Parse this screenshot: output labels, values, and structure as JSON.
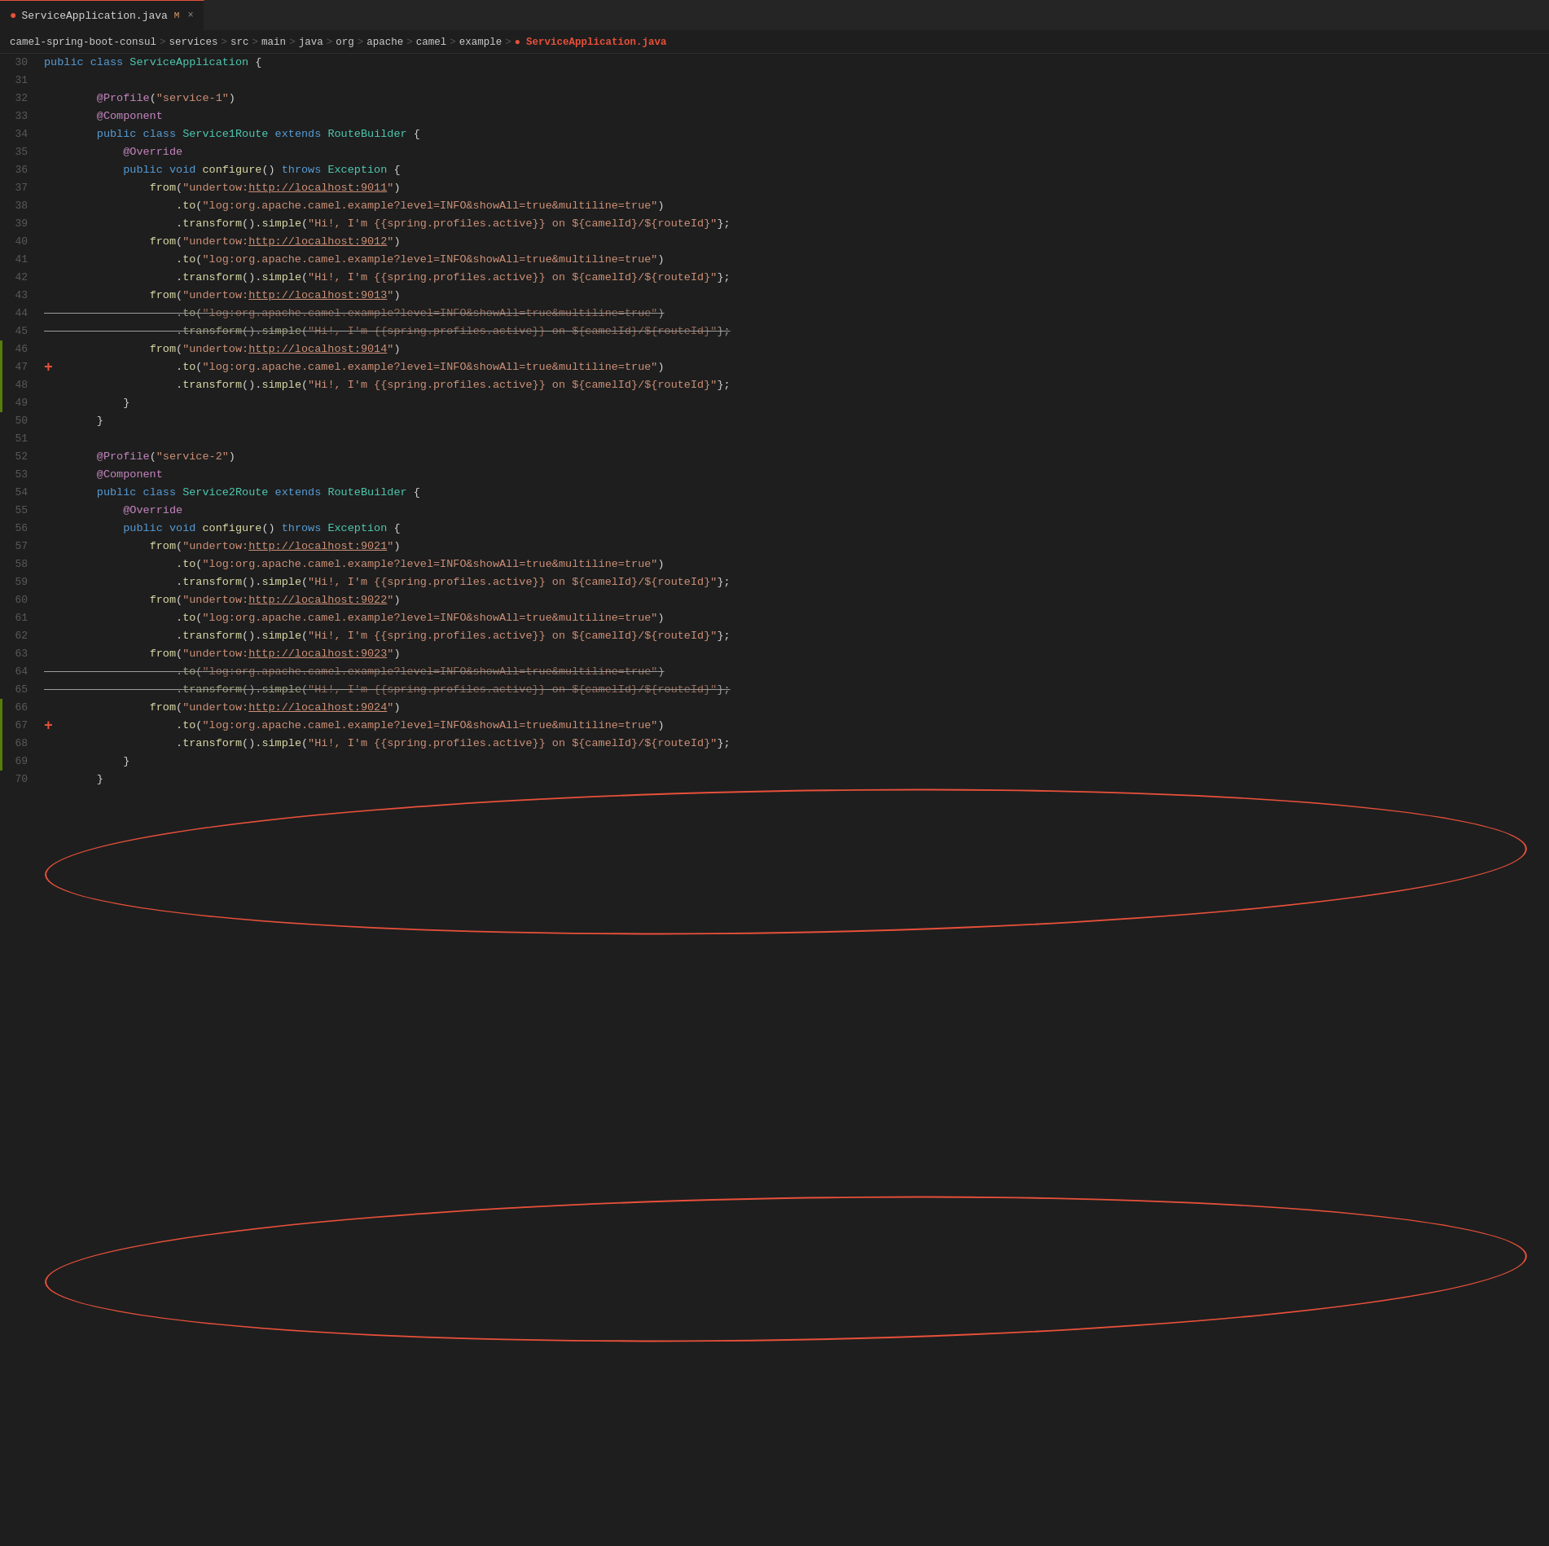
{
  "tab": {
    "icon": "●",
    "filename": "ServiceApplication.java",
    "modified": "M",
    "close": "×"
  },
  "breadcrumb": {
    "parts": [
      "camel-spring-boot-consul",
      "services",
      "src",
      "main",
      "java",
      "org",
      "apache",
      "camel",
      "example",
      "ServiceApplication.java"
    ]
  },
  "lines": [
    {
      "num": "30",
      "tokens": [
        {
          "t": "kw",
          "v": "public"
        },
        {
          "t": "plain",
          "v": " "
        },
        {
          "t": "kw",
          "v": "class"
        },
        {
          "t": "plain",
          "v": " "
        },
        {
          "t": "type",
          "v": "ServiceApplication"
        },
        {
          "t": "plain",
          "v": " {"
        }
      ]
    },
    {
      "num": "31",
      "tokens": []
    },
    {
      "num": "32",
      "tokens": [
        {
          "t": "plain",
          "v": "        "
        },
        {
          "t": "annot",
          "v": "@Profile"
        },
        {
          "t": "plain",
          "v": "("
        },
        {
          "t": "str",
          "v": "\"service-1\""
        },
        {
          "t": "plain",
          "v": ")"
        }
      ]
    },
    {
      "num": "33",
      "tokens": [
        {
          "t": "plain",
          "v": "        "
        },
        {
          "t": "annot",
          "v": "@Component"
        }
      ]
    },
    {
      "num": "34",
      "tokens": [
        {
          "t": "plain",
          "v": "        "
        },
        {
          "t": "kw",
          "v": "public"
        },
        {
          "t": "plain",
          "v": " "
        },
        {
          "t": "kw",
          "v": "class"
        },
        {
          "t": "plain",
          "v": " "
        },
        {
          "t": "type",
          "v": "Service1Route"
        },
        {
          "t": "plain",
          "v": " "
        },
        {
          "t": "kw",
          "v": "extends"
        },
        {
          "t": "plain",
          "v": " "
        },
        {
          "t": "type",
          "v": "RouteBuilder"
        },
        {
          "t": "plain",
          "v": " {"
        }
      ]
    },
    {
      "num": "35",
      "tokens": [
        {
          "t": "plain",
          "v": "            "
        },
        {
          "t": "annot",
          "v": "@Override"
        }
      ]
    },
    {
      "num": "36",
      "tokens": [
        {
          "t": "plain",
          "v": "            "
        },
        {
          "t": "kw",
          "v": "public"
        },
        {
          "t": "plain",
          "v": " "
        },
        {
          "t": "kw",
          "v": "void"
        },
        {
          "t": "plain",
          "v": " "
        },
        {
          "t": "fn",
          "v": "configure"
        },
        {
          "t": "plain",
          "v": "() "
        },
        {
          "t": "kw",
          "v": "throws"
        },
        {
          "t": "plain",
          "v": " "
        },
        {
          "t": "type",
          "v": "Exception"
        },
        {
          "t": "plain",
          "v": " {"
        }
      ]
    },
    {
      "num": "37",
      "tokens": [
        {
          "t": "plain",
          "v": "                "
        },
        {
          "t": "fn",
          "v": "from"
        },
        {
          "t": "plain",
          "v": "("
        },
        {
          "t": "str",
          "v": "\"undertow:"
        },
        {
          "t": "str-link",
          "v": "http://localhost:9011"
        },
        {
          "t": "str",
          "v": "\""
        },
        {
          "t": "plain",
          "v": ")"
        }
      ]
    },
    {
      "num": "38",
      "tokens": [
        {
          "t": "plain",
          "v": "                    ."
        },
        {
          "t": "fn",
          "v": "to"
        },
        {
          "t": "plain",
          "v": "("
        },
        {
          "t": "str",
          "v": "\"log:org.apache.camel.example?level=INFO&showAll=true&multiline=true\""
        },
        {
          "t": "plain",
          "v": ")"
        }
      ]
    },
    {
      "num": "39",
      "tokens": [
        {
          "t": "plain",
          "v": "                    ."
        },
        {
          "t": "fn",
          "v": "transform"
        },
        {
          "t": "plain",
          "v": "()."
        },
        {
          "t": "fn",
          "v": "simple"
        },
        {
          "t": "plain",
          "v": "("
        },
        {
          "t": "str",
          "v": "\"Hi!, I'm {{spring.profiles.active}} on ${camelId}/${routeId}\""
        },
        {
          "t": "plain",
          "v": "};"
        }
      ]
    },
    {
      "num": "40",
      "tokens": [
        {
          "t": "plain",
          "v": "                "
        },
        {
          "t": "fn",
          "v": "from"
        },
        {
          "t": "plain",
          "v": "("
        },
        {
          "t": "str",
          "v": "\"undertow:"
        },
        {
          "t": "str-link",
          "v": "http://localhost:9012"
        },
        {
          "t": "str",
          "v": "\""
        },
        {
          "t": "plain",
          "v": ")"
        }
      ]
    },
    {
      "num": "41",
      "tokens": [
        {
          "t": "plain",
          "v": "                    ."
        },
        {
          "t": "fn",
          "v": "to"
        },
        {
          "t": "plain",
          "v": "("
        },
        {
          "t": "str",
          "v": "\"log:org.apache.camel.example?level=INFO&showAll=true&multiline=true\""
        },
        {
          "t": "plain",
          "v": ")"
        }
      ]
    },
    {
      "num": "42",
      "tokens": [
        {
          "t": "plain",
          "v": "                    ."
        },
        {
          "t": "fn",
          "v": "transform"
        },
        {
          "t": "plain",
          "v": "()."
        },
        {
          "t": "fn",
          "v": "simple"
        },
        {
          "t": "plain",
          "v": "("
        },
        {
          "t": "str",
          "v": "\"Hi!, I'm {{spring.profiles.active}} on ${camelId}/${routeId}\""
        },
        {
          "t": "plain",
          "v": "};"
        }
      ]
    },
    {
      "num": "43",
      "tokens": [
        {
          "t": "plain",
          "v": "                "
        },
        {
          "t": "fn",
          "v": "from"
        },
        {
          "t": "plain",
          "v": "("
        },
        {
          "t": "str",
          "v": "\"undertow:"
        },
        {
          "t": "str-link",
          "v": "http://localhost:9013"
        },
        {
          "t": "str",
          "v": "\""
        },
        {
          "t": "plain",
          "v": ")"
        }
      ]
    },
    {
      "num": "44",
      "tokens": [
        {
          "t": "plain",
          "v": "                    ."
        },
        {
          "t": "fn",
          "v": "to"
        },
        {
          "t": "plain",
          "v": "("
        },
        {
          "t": "str",
          "v": "\"log:org.apache.camel.example?level=INFO&showAll=true&multiline=true\""
        },
        {
          "t": "plain",
          "v": ")"
        }
      ],
      "strikethrough": true
    },
    {
      "num": "45",
      "tokens": [
        {
          "t": "plain",
          "v": "                    ."
        },
        {
          "t": "fn",
          "v": "transform"
        },
        {
          "t": "plain",
          "v": "()."
        },
        {
          "t": "fn",
          "v": "simple"
        },
        {
          "t": "plain",
          "v": "("
        },
        {
          "t": "str",
          "v": "\"Hi!, I'm {{spring.profiles.active}} on ${camelId}/${routeId}\""
        },
        {
          "t": "plain",
          "v": "};"
        }
      ],
      "strikethrough": true
    },
    {
      "num": "46",
      "tokens": [
        {
          "t": "plain",
          "v": "                "
        },
        {
          "t": "fn",
          "v": "from"
        },
        {
          "t": "plain",
          "v": "("
        },
        {
          "t": "str",
          "v": "\"undertow:"
        },
        {
          "t": "str-link",
          "v": "http://localhost:9014"
        },
        {
          "t": "str",
          "v": "\""
        },
        {
          "t": "plain",
          "v": ")"
        }
      ],
      "gitAdd": true
    },
    {
      "num": "47",
      "tokens": [
        {
          "t": "plain",
          "v": "                    ."
        },
        {
          "t": "fn",
          "v": "to"
        },
        {
          "t": "plain",
          "v": "("
        },
        {
          "t": "str",
          "v": "\"log:org.apache.camel.example?level=INFO&showAll=true&multiline=true\""
        },
        {
          "t": "plain",
          "v": ")"
        }
      ],
      "gitAdd": true,
      "plusMarker": true
    },
    {
      "num": "48",
      "tokens": [
        {
          "t": "plain",
          "v": "                    ."
        },
        {
          "t": "fn",
          "v": "transform"
        },
        {
          "t": "plain",
          "v": "()."
        },
        {
          "t": "fn",
          "v": "simple"
        },
        {
          "t": "plain",
          "v": "("
        },
        {
          "t": "str",
          "v": "\"Hi!, I'm {{spring.profiles.active}} on ${camelId}/${routeId}\""
        },
        {
          "t": "plain",
          "v": "};"
        }
      ],
      "gitAdd": true
    },
    {
      "num": "49",
      "tokens": [
        {
          "t": "plain",
          "v": "            }"
        }
      ],
      "gitAdd": true
    },
    {
      "num": "50",
      "tokens": [
        {
          "t": "plain",
          "v": "        }"
        }
      ]
    },
    {
      "num": "51",
      "tokens": []
    },
    {
      "num": "52",
      "tokens": [
        {
          "t": "plain",
          "v": "        "
        },
        {
          "t": "annot",
          "v": "@Profile"
        },
        {
          "t": "plain",
          "v": "("
        },
        {
          "t": "str",
          "v": "\"service-2\""
        },
        {
          "t": "plain",
          "v": ")"
        }
      ]
    },
    {
      "num": "53",
      "tokens": [
        {
          "t": "plain",
          "v": "        "
        },
        {
          "t": "annot",
          "v": "@Component"
        }
      ]
    },
    {
      "num": "54",
      "tokens": [
        {
          "t": "plain",
          "v": "        "
        },
        {
          "t": "kw",
          "v": "public"
        },
        {
          "t": "plain",
          "v": " "
        },
        {
          "t": "kw",
          "v": "class"
        },
        {
          "t": "plain",
          "v": " "
        },
        {
          "t": "type",
          "v": "Service2Route"
        },
        {
          "t": "plain",
          "v": " "
        },
        {
          "t": "kw",
          "v": "extends"
        },
        {
          "t": "plain",
          "v": " "
        },
        {
          "t": "type",
          "v": "RouteBuilder"
        },
        {
          "t": "plain",
          "v": " {"
        }
      ]
    },
    {
      "num": "55",
      "tokens": [
        {
          "t": "plain",
          "v": "            "
        },
        {
          "t": "annot",
          "v": "@Override"
        }
      ]
    },
    {
      "num": "56",
      "tokens": [
        {
          "t": "plain",
          "v": "            "
        },
        {
          "t": "kw",
          "v": "public"
        },
        {
          "t": "plain",
          "v": " "
        },
        {
          "t": "kw",
          "v": "void"
        },
        {
          "t": "plain",
          "v": " "
        },
        {
          "t": "fn",
          "v": "configure"
        },
        {
          "t": "plain",
          "v": "() "
        },
        {
          "t": "kw",
          "v": "throws"
        },
        {
          "t": "plain",
          "v": " "
        },
        {
          "t": "type",
          "v": "Exception"
        },
        {
          "t": "plain",
          "v": " {"
        }
      ]
    },
    {
      "num": "57",
      "tokens": [
        {
          "t": "plain",
          "v": "                "
        },
        {
          "t": "fn",
          "v": "from"
        },
        {
          "t": "plain",
          "v": "("
        },
        {
          "t": "str",
          "v": "\"undertow:"
        },
        {
          "t": "str-link",
          "v": "http://localhost:9021"
        },
        {
          "t": "str",
          "v": "\""
        },
        {
          "t": "plain",
          "v": ")"
        }
      ]
    },
    {
      "num": "58",
      "tokens": [
        {
          "t": "plain",
          "v": "                    ."
        },
        {
          "t": "fn",
          "v": "to"
        },
        {
          "t": "plain",
          "v": "("
        },
        {
          "t": "str",
          "v": "\"log:org.apache.camel.example?level=INFO&showAll=true&multiline=true\""
        },
        {
          "t": "plain",
          "v": ")"
        }
      ]
    },
    {
      "num": "59",
      "tokens": [
        {
          "t": "plain",
          "v": "                    ."
        },
        {
          "t": "fn",
          "v": "transform"
        },
        {
          "t": "plain",
          "v": "()."
        },
        {
          "t": "fn",
          "v": "simple"
        },
        {
          "t": "plain",
          "v": "("
        },
        {
          "t": "str",
          "v": "\"Hi!, I'm {{spring.profiles.active}} on ${camelId}/${routeId}\""
        },
        {
          "t": "plain",
          "v": "};"
        }
      ]
    },
    {
      "num": "60",
      "tokens": [
        {
          "t": "plain",
          "v": "                "
        },
        {
          "t": "fn",
          "v": "from"
        },
        {
          "t": "plain",
          "v": "("
        },
        {
          "t": "str",
          "v": "\"undertow:"
        },
        {
          "t": "str-link",
          "v": "http://localhost:9022"
        },
        {
          "t": "str",
          "v": "\""
        },
        {
          "t": "plain",
          "v": ")"
        }
      ]
    },
    {
      "num": "61",
      "tokens": [
        {
          "t": "plain",
          "v": "                    ."
        },
        {
          "t": "fn",
          "v": "to"
        },
        {
          "t": "plain",
          "v": "("
        },
        {
          "t": "str",
          "v": "\"log:org.apache.camel.example?level=INFO&showAll=true&multiline=true\""
        },
        {
          "t": "plain",
          "v": ")"
        }
      ]
    },
    {
      "num": "62",
      "tokens": [
        {
          "t": "plain",
          "v": "                    ."
        },
        {
          "t": "fn",
          "v": "transform"
        },
        {
          "t": "plain",
          "v": "()."
        },
        {
          "t": "fn",
          "v": "simple"
        },
        {
          "t": "plain",
          "v": "("
        },
        {
          "t": "str",
          "v": "\"Hi!, I'm {{spring.profiles.active}} on ${camelId}/${routeId}\""
        },
        {
          "t": "plain",
          "v": "};"
        }
      ]
    },
    {
      "num": "63",
      "tokens": [
        {
          "t": "plain",
          "v": "                "
        },
        {
          "t": "fn",
          "v": "from"
        },
        {
          "t": "plain",
          "v": "("
        },
        {
          "t": "str",
          "v": "\"undertow:"
        },
        {
          "t": "str-link",
          "v": "http://localhost:9023"
        },
        {
          "t": "str",
          "v": "\""
        },
        {
          "t": "plain",
          "v": ")"
        }
      ]
    },
    {
      "num": "64",
      "tokens": [
        {
          "t": "plain",
          "v": "                    ."
        },
        {
          "t": "fn",
          "v": "to"
        },
        {
          "t": "plain",
          "v": "("
        },
        {
          "t": "str",
          "v": "\"log:org.apache.camel.example?level=INFO&showAll=true&multiline=true\""
        },
        {
          "t": "plain",
          "v": ")"
        }
      ],
      "strikethrough": true
    },
    {
      "num": "65",
      "tokens": [
        {
          "t": "plain",
          "v": "                    ."
        },
        {
          "t": "fn",
          "v": "transform"
        },
        {
          "t": "plain",
          "v": "()."
        },
        {
          "t": "fn",
          "v": "simple"
        },
        {
          "t": "plain",
          "v": "("
        },
        {
          "t": "str",
          "v": "\"Hi!, I'm {{spring.profiles.active}} on ${camelId}/${routeId}\""
        },
        {
          "t": "plain",
          "v": "};"
        }
      ],
      "strikethrough": true
    },
    {
      "num": "66",
      "tokens": [
        {
          "t": "plain",
          "v": "                "
        },
        {
          "t": "fn",
          "v": "from"
        },
        {
          "t": "plain",
          "v": "("
        },
        {
          "t": "str",
          "v": "\"undertow:"
        },
        {
          "t": "str-link",
          "v": "http://localhost:9024"
        },
        {
          "t": "str",
          "v": "\""
        },
        {
          "t": "plain",
          "v": ")"
        }
      ],
      "gitAdd": true
    },
    {
      "num": "67",
      "tokens": [
        {
          "t": "plain",
          "v": "                    ."
        },
        {
          "t": "fn",
          "v": "to"
        },
        {
          "t": "plain",
          "v": "("
        },
        {
          "t": "str",
          "v": "\"log:org.apache.camel.example?level=INFO&showAll=true&multiline=true\""
        },
        {
          "t": "plain",
          "v": ")"
        }
      ],
      "gitAdd": true,
      "plusMarker": true
    },
    {
      "num": "68",
      "tokens": [
        {
          "t": "plain",
          "v": "                    ."
        },
        {
          "t": "fn",
          "v": "transform"
        },
        {
          "t": "plain",
          "v": "()."
        },
        {
          "t": "fn",
          "v": "simple"
        },
        {
          "t": "plain",
          "v": "("
        },
        {
          "t": "str",
          "v": "\"Hi!, I'm {{spring.profiles.active}} on ${camelId}/${routeId}\""
        },
        {
          "t": "plain",
          "v": "};"
        }
      ],
      "gitAdd": true
    },
    {
      "num": "69",
      "tokens": [
        {
          "t": "plain",
          "v": "            }"
        }
      ],
      "gitAdd": true
    },
    {
      "num": "70",
      "tokens": [
        {
          "t": "plain",
          "v": "        }"
        }
      ]
    }
  ],
  "oval1": {
    "label": "oval-annotation-1"
  },
  "oval2": {
    "label": "oval-annotation-2"
  }
}
